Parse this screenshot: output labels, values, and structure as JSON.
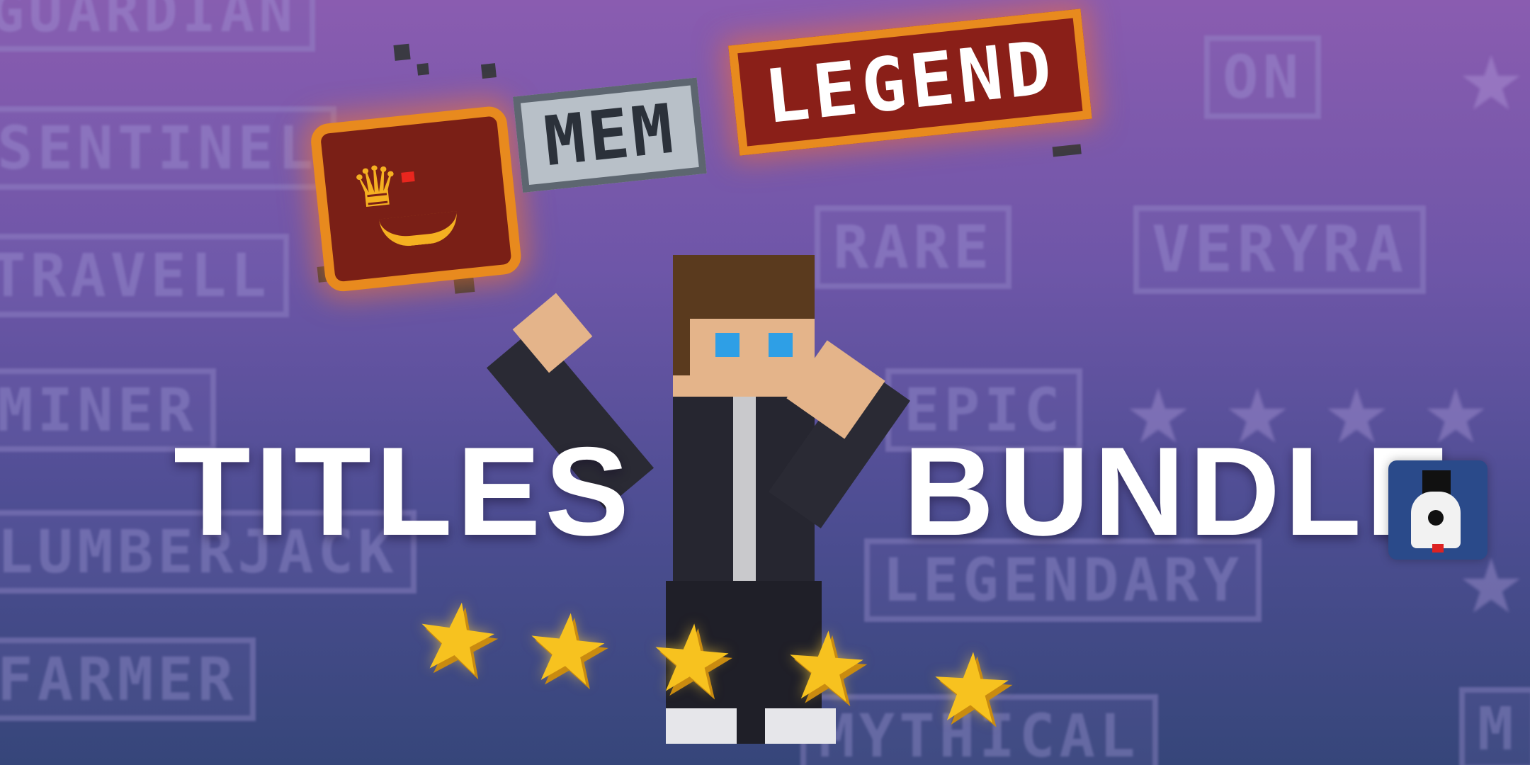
{
  "background": {
    "badges": [
      "GUARDIAN",
      "SENTINEL",
      "TRAVELL",
      "MINER",
      "LUMBERJACK",
      "FARMER",
      "RARE",
      "VERYRA",
      "EPIC",
      "LEGENDARY",
      "MYTHICAL",
      "ON",
      "M"
    ]
  },
  "crest": {
    "icon": "crown-crest-icon"
  },
  "tags": {
    "mem": "MEM",
    "legend": "LEGEND"
  },
  "title": {
    "left": "TITLES",
    "right": "BUNDLE"
  },
  "stars": {
    "count": 5,
    "icon": "star-icon"
  },
  "ghost": {
    "icon": "ghost-top-hat-icon"
  },
  "colors": {
    "bg_top": "#8a5cb0",
    "bg_bottom": "#36467a",
    "legend_red": "#8a1f18",
    "legend_orange": "#e88a1e",
    "star_yellow": "#f7c21f"
  }
}
